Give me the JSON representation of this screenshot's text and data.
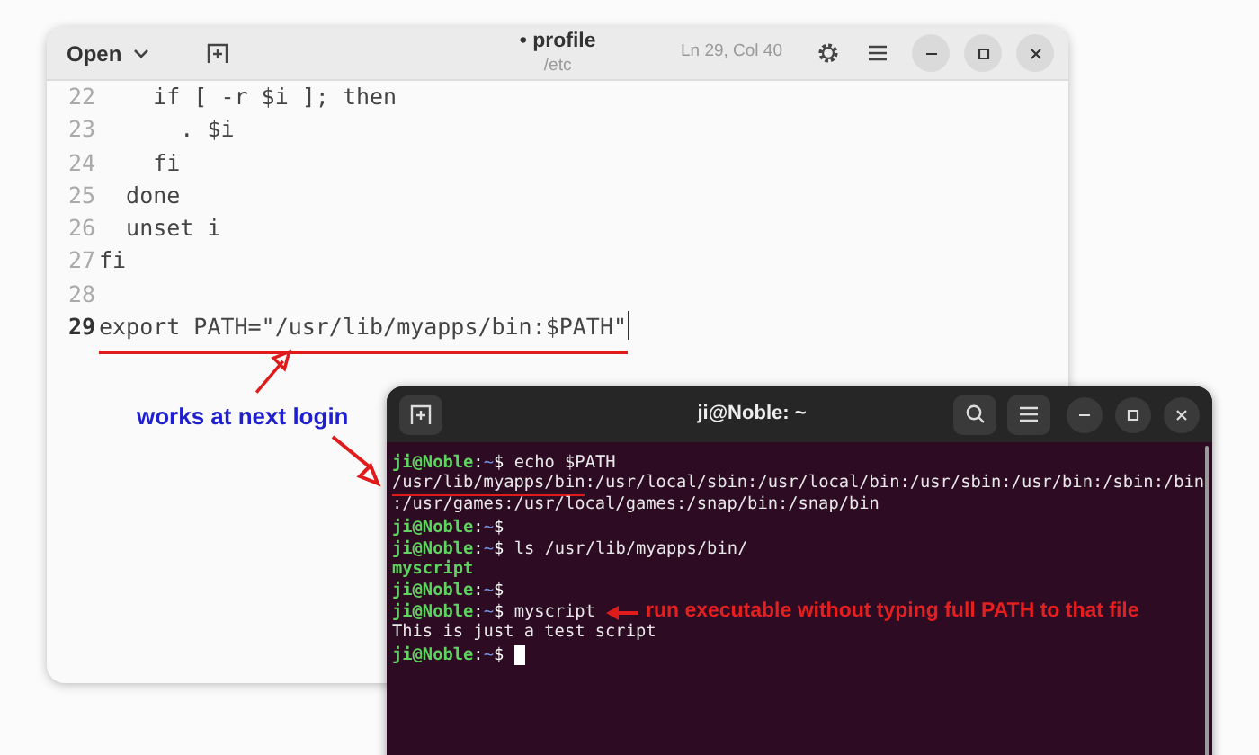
{
  "editor": {
    "open_label": "Open",
    "title": "profile",
    "modified": true,
    "modified_mark": "•",
    "subtitle": "/etc",
    "position": "Ln 29, Col 40",
    "lines": [
      {
        "number": "22",
        "text": "    if [ -r $i ]; then",
        "current": false
      },
      {
        "number": "23",
        "text": "      . $i",
        "current": false
      },
      {
        "number": "24",
        "text": "    fi",
        "current": false
      },
      {
        "number": "25",
        "text": "  done",
        "current": false
      },
      {
        "number": "26",
        "text": "  unset i",
        "current": false
      },
      {
        "number": "27",
        "text": "fi",
        "current": false
      },
      {
        "number": "28",
        "current": false
      },
      {
        "number": "29",
        "text": "export PATH=\"/usr/lib/myapps/bin:$PATH\"",
        "current": true,
        "underlined": true
      }
    ]
  },
  "editor_note": {
    "text": "works at next login",
    "color": "#1f1fd0"
  },
  "terminal": {
    "title": "ji@Noble: ~",
    "lines": [
      {
        "kind": "prompt",
        "user": "ji@Noble",
        "sep": ":",
        "dir": "~",
        "sign": "$",
        "command": "echo $PATH"
      },
      {
        "kind": "output",
        "segments": [
          {
            "text": "/usr/lib/myapps/bin",
            "underlined": true
          },
          {
            "text": ":/usr/local/sbin:/usr/local/bin:/usr/sbin:/usr/bin:/sbin:/bin",
            "underlined": false
          }
        ]
      },
      {
        "kind": "output",
        "segments": [
          {
            "text": ":/usr/games:/usr/local/games:/snap/bin:/snap/bin",
            "underlined": false
          }
        ]
      },
      {
        "kind": "prompt",
        "user": "ji@Noble",
        "sep": ":",
        "dir": "~",
        "sign": "$"
      },
      {
        "kind": "prompt",
        "user": "ji@Noble",
        "sep": ":",
        "dir": "~",
        "sign": "$",
        "command": "ls /usr/lib/myapps/bin/"
      },
      {
        "kind": "executable",
        "text": "myscript"
      },
      {
        "kind": "prompt",
        "user": "ji@Noble",
        "sep": ":",
        "dir": "~",
        "sign": "$"
      },
      {
        "kind": "prompt",
        "user": "ji@Noble",
        "sep": ":",
        "dir": "~",
        "sign": "$",
        "command": "myscript",
        "note": "run executable without typing full PATH to that file"
      },
      {
        "kind": "output",
        "segments": [
          {
            "text": "This is just a test script",
            "underlined": false
          }
        ]
      },
      {
        "kind": "prompt",
        "user": "ji@Noble",
        "sep": ":",
        "dir": "~",
        "sign": "$",
        "cursor": true
      }
    ]
  }
}
